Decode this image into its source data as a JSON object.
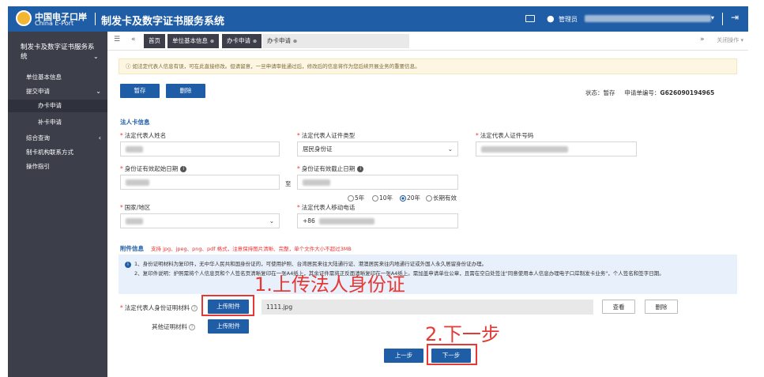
{
  "header": {
    "logo_cn": "中国电子口岸",
    "logo_en": "China E-Port",
    "system_title": "制发卡及数字证书服务系统",
    "user_label": "管理员",
    "user_dropdown": "▾",
    "logout_icon": "logout-icon",
    "mail_icon": "mail-icon"
  },
  "sidebar": {
    "title": "制发卡及数字证书服务系统",
    "items": [
      {
        "label": "单位基本信息"
      },
      {
        "label": "提交申请"
      },
      {
        "label": "办卡申请"
      },
      {
        "label": "补卡申请"
      },
      {
        "label": "综合查询"
      },
      {
        "label": "制卡机构联系方式"
      },
      {
        "label": "操作指引"
      }
    ]
  },
  "tabs": {
    "home": "首页",
    "items": [
      {
        "label": "单位基本信息"
      },
      {
        "label": "办卡申请"
      },
      {
        "label": "办卡申请"
      }
    ],
    "close_menu": "关闭操作"
  },
  "notice": "如法定代表人信息有误，可在此直接修改。但请留意，一旦申请审批通过后，修改后的信息将作为您后续开展业务的重要信息。",
  "actions": {
    "save": "暂存",
    "delete": "删除"
  },
  "status": {
    "status_label": "状态：",
    "status_value": "暂存",
    "number_label": "申请单编号：",
    "number_value": "G626090194965"
  },
  "legal": {
    "section_title": "法人卡信息",
    "name_label": "法定代表人姓名",
    "id_type_label": "法定代表人证件类型",
    "id_type_value": "居民身份证",
    "id_no_label": "法定代表人证件号码",
    "start_date_label": "身份证有效起始日期",
    "end_date_label": "身份证有效截止日期",
    "date_to": "至",
    "validity_options": [
      {
        "label": "5年",
        "selected": false
      },
      {
        "label": "10年",
        "selected": false
      },
      {
        "label": "20年",
        "selected": true
      },
      {
        "label": "长期有效",
        "selected": false
      }
    ],
    "country_label": "国家/地区",
    "phone_label": "法定代表人移动电话",
    "phone_prefix": "+86"
  },
  "attachments": {
    "section_title": "附件信息",
    "tip": "支持 jpg、jpeg、png、pdf 格式，注意保持图片清晰、完整，单个文件大小不超过3MB",
    "instructions": [
      "1、身份证明材料为复印件，无中华人民共和国身份证的，可使用护照、台湾居民来往大陆通行证、港澳居民来往内地通行证或外国人永久居留身份证办理。",
      "2、复印件说明：护照需将个人信息页和个人签名页清晰复印在一张A4纸上，其余证件需将正反面清晰复印在一张A4纸上。需加盖申请单位公章，且需在空白处签注\"同意使用本人信息办理电子口岸制发卡业务\"，个人签名和签字日期。"
    ],
    "id_material_label": "法定代表人身份证明材料",
    "upload_label": "上传附件",
    "file_name": "1111.jpg",
    "view_label": "查看",
    "delete_label": "删除",
    "other_label": "其他证明材料",
    "upload_label_2": "上传附件"
  },
  "nav": {
    "prev": "上一步",
    "next": "下一步"
  },
  "annotations": {
    "step1": "1.上传法人身份证",
    "step2": "2.下一步",
    "color": "#e53935"
  }
}
